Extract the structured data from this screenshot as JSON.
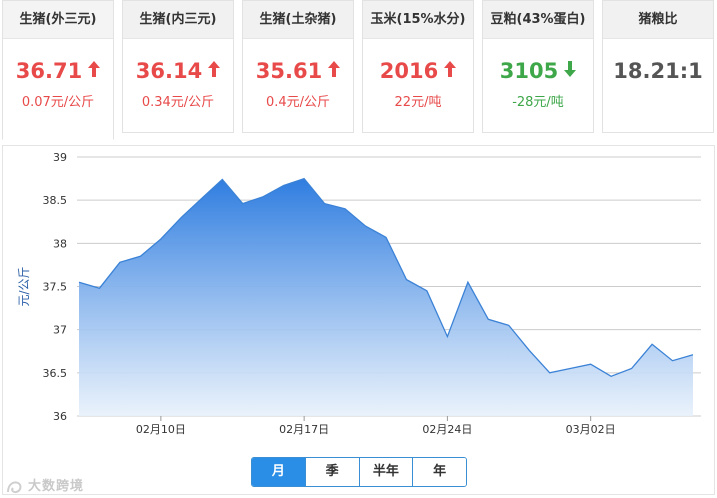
{
  "cards": [
    {
      "title": "生猪(外三元)",
      "price": "36.71",
      "change": "0.07元/公斤",
      "direction": "up"
    },
    {
      "title": "生猪(内三元)",
      "price": "36.14",
      "change": "0.34元/公斤",
      "direction": "up"
    },
    {
      "title": "生猪(土杂猪)",
      "price": "35.61",
      "change": "0.4元/公斤",
      "direction": "up"
    },
    {
      "title": "玉米(15%水分)",
      "price": "2016",
      "change": "22元/吨",
      "direction": "up"
    },
    {
      "title": "豆粕(43%蛋白)",
      "price": "3105",
      "change": "-28元/吨",
      "direction": "down"
    },
    {
      "title": "猪粮比",
      "price": "18.21:1",
      "change": "",
      "direction": "none"
    }
  ],
  "colors": {
    "up": "#e84a4a",
    "down": "#3ea74a",
    "line": "#3b82d6",
    "accent": "#2a8ee6"
  },
  "range_buttons": [
    {
      "label": "月",
      "active": true
    },
    {
      "label": "季",
      "active": false
    },
    {
      "label": "半年",
      "active": false
    },
    {
      "label": "年",
      "active": false
    }
  ],
  "watermark": "大数跨境",
  "chart_data": {
    "type": "area",
    "title": "",
    "ylabel": "元/公斤",
    "xlabel": "",
    "ylim": [
      36,
      39
    ],
    "yticks": [
      "36",
      "36.5",
      "37",
      "37.5",
      "38",
      "38.5",
      "39"
    ],
    "xticks": [
      "02月10日",
      "02月17日",
      "02月24日",
      "03月02日"
    ],
    "grid": true,
    "series": [
      {
        "values": [
          37.55,
          37.48,
          37.78,
          37.85,
          38.05,
          38.3,
          38.52,
          38.74,
          38.46,
          38.54,
          38.67,
          38.75,
          38.46,
          38.4,
          38.2,
          38.07,
          37.58,
          37.45,
          36.92,
          37.55,
          37.12,
          37.05,
          36.76,
          36.5,
          36.55,
          36.6,
          36.46,
          36.55,
          36.83,
          36.64,
          36.71
        ]
      }
    ]
  }
}
